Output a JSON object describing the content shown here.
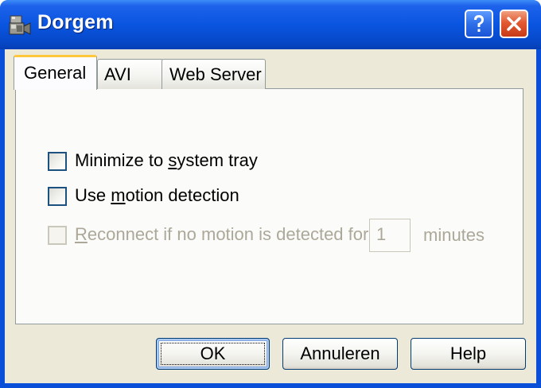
{
  "window": {
    "title": "Dorgem",
    "icon": "camera-app-icon",
    "caption_buttons": [
      "help-icon",
      "close-icon"
    ]
  },
  "tabs": [
    {
      "label": "General",
      "selected": true
    },
    {
      "label": "AVI",
      "selected": false
    },
    {
      "label": "Web Server",
      "selected": false
    }
  ],
  "options": {
    "minimize": {
      "pre": "Minimize to ",
      "accel": "s",
      "post": "ystem tray",
      "checked": false,
      "enabled": true
    },
    "motion": {
      "pre": "Use ",
      "accel": "m",
      "post": "otion detection",
      "checked": false,
      "enabled": true
    },
    "reconnect": {
      "pre": "",
      "accel": "R",
      "post": "econnect if no motion is detected for",
      "checked": false,
      "enabled": false
    }
  },
  "reconnect_minutes": {
    "value": "1",
    "unit_label": "minutes"
  },
  "buttons": {
    "ok": "OK",
    "cancel": "Annuleren",
    "help": "Help"
  },
  "colors": {
    "titlebar": "#0a55e0",
    "dialog_face": "#ece9d8",
    "selected_tab_accent": "#ffc83c",
    "disabled_text": "#aca899"
  }
}
